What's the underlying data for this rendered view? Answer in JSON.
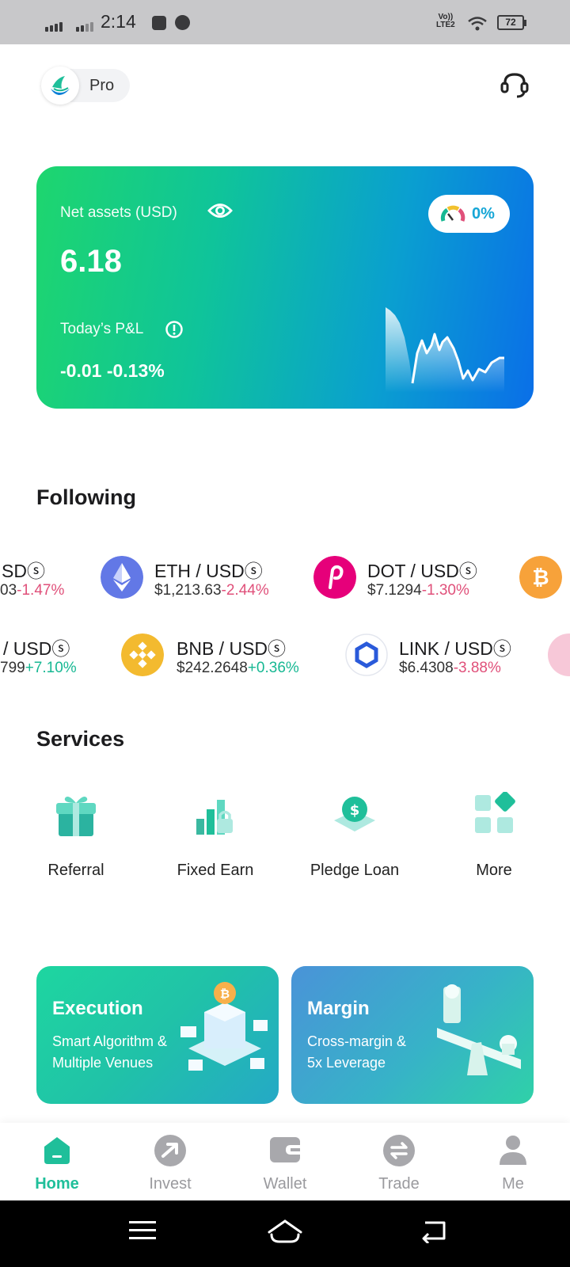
{
  "status_bar": {
    "time": "2:14",
    "network_top": "Vo))",
    "network_bottom": "LTE2",
    "battery": "72"
  },
  "header": {
    "mode_label": "Pro"
  },
  "asset_card": {
    "net_assets_label": "Net assets (USD)",
    "net_assets_value": "6.18",
    "risk_label": "0%",
    "pnl_label": "Today’s P&L",
    "pnl_value": "-0.01 -0.13%"
  },
  "following": {
    "title": "Following",
    "row1": [
      {
        "name": "SDⓢ",
        "price": "",
        "price_partial": "03",
        "change": "-1.47%",
        "trend": "neg",
        "icon": "partial"
      },
      {
        "name": "ETH / USDⓢ",
        "price": "$1,213.63",
        "change": "-2.44%",
        "trend": "neg",
        "icon": "eth-icon"
      },
      {
        "name": "DOT / USDⓢ",
        "price": "$7.1294",
        "change": "-1.30%",
        "trend": "neg",
        "icon": "dot-icon"
      },
      {
        "name": "",
        "price": "",
        "change": "",
        "trend": "neg",
        "icon": "btc-icon"
      }
    ],
    "row2": [
      {
        "name": "/ USDⓢ",
        "price_partial": "799",
        "change": "+7.10%",
        "trend": "pos",
        "icon": "partial"
      },
      {
        "name": "BNB / USDⓢ",
        "price": "$242.2648",
        "change": "+0.36%",
        "trend": "pos",
        "icon": "bnb-icon"
      },
      {
        "name": "LINK / USDⓢ",
        "price": "$6.4308",
        "change": "-3.88%",
        "trend": "neg",
        "icon": "link-icon"
      }
    ]
  },
  "services": {
    "title": "Services",
    "items": [
      {
        "label": "Referral",
        "icon": "gift-icon"
      },
      {
        "label": "Fixed Earn",
        "icon": "earn-icon"
      },
      {
        "label": "Pledge Loan",
        "icon": "loan-icon"
      },
      {
        "label": "More",
        "icon": "grid-icon"
      }
    ]
  },
  "promos": [
    {
      "title": "Execution",
      "line1": "Smart Algorithm &",
      "line2": "Multiple Venues"
    },
    {
      "title": "Margin",
      "line1": "Cross-margin &",
      "line2": "5x Leverage"
    }
  ],
  "bottom_nav": [
    {
      "label": "Home",
      "active": true
    },
    {
      "label": "Invest"
    },
    {
      "label": "Wallet"
    },
    {
      "label": "Trade"
    },
    {
      "label": "Me"
    }
  ],
  "colors": {
    "accent": "#1fbf9a",
    "negative": "#e0507a",
    "positive": "#17b893"
  }
}
